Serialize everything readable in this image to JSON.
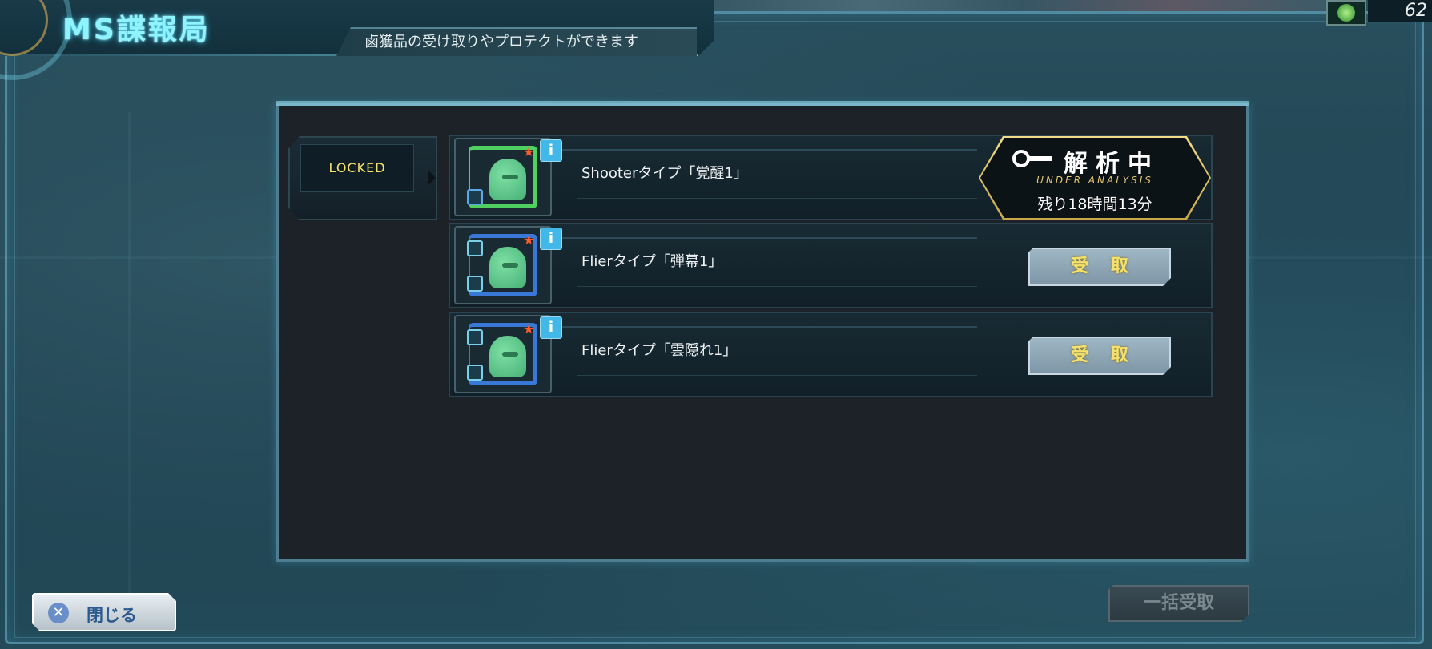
{
  "header": {
    "title": "MS諜報局",
    "subtitle": "鹵獲品の受け取りやプロテクトができます"
  },
  "corner": {
    "value": "62"
  },
  "locked": {
    "label": "LOCKED"
  },
  "items": [
    {
      "name": "Shooterタイプ「覚醒1」",
      "frame": "green",
      "status": "analysis"
    },
    {
      "name": "Flierタイプ「弾幕1」",
      "frame": "blue",
      "action": "受 取"
    },
    {
      "name": "Flierタイプ「雲隠れ1」",
      "frame": "blue",
      "action": "受 取"
    }
  ],
  "analysis": {
    "title": "解析中",
    "subtitle": "UNDER ANALYSIS",
    "time_remaining": "残り18時間13分"
  },
  "info_icon": "i",
  "footer": {
    "close_label": "閉じる",
    "bulk_receive_label": "一括受取"
  },
  "colors": {
    "title_glow": "#8ff4ff",
    "locked_text": "#f6e36a",
    "receive_text": "#f6e26a",
    "analysis_gold": "#e3c774",
    "info_blue": "#41b8e8"
  }
}
